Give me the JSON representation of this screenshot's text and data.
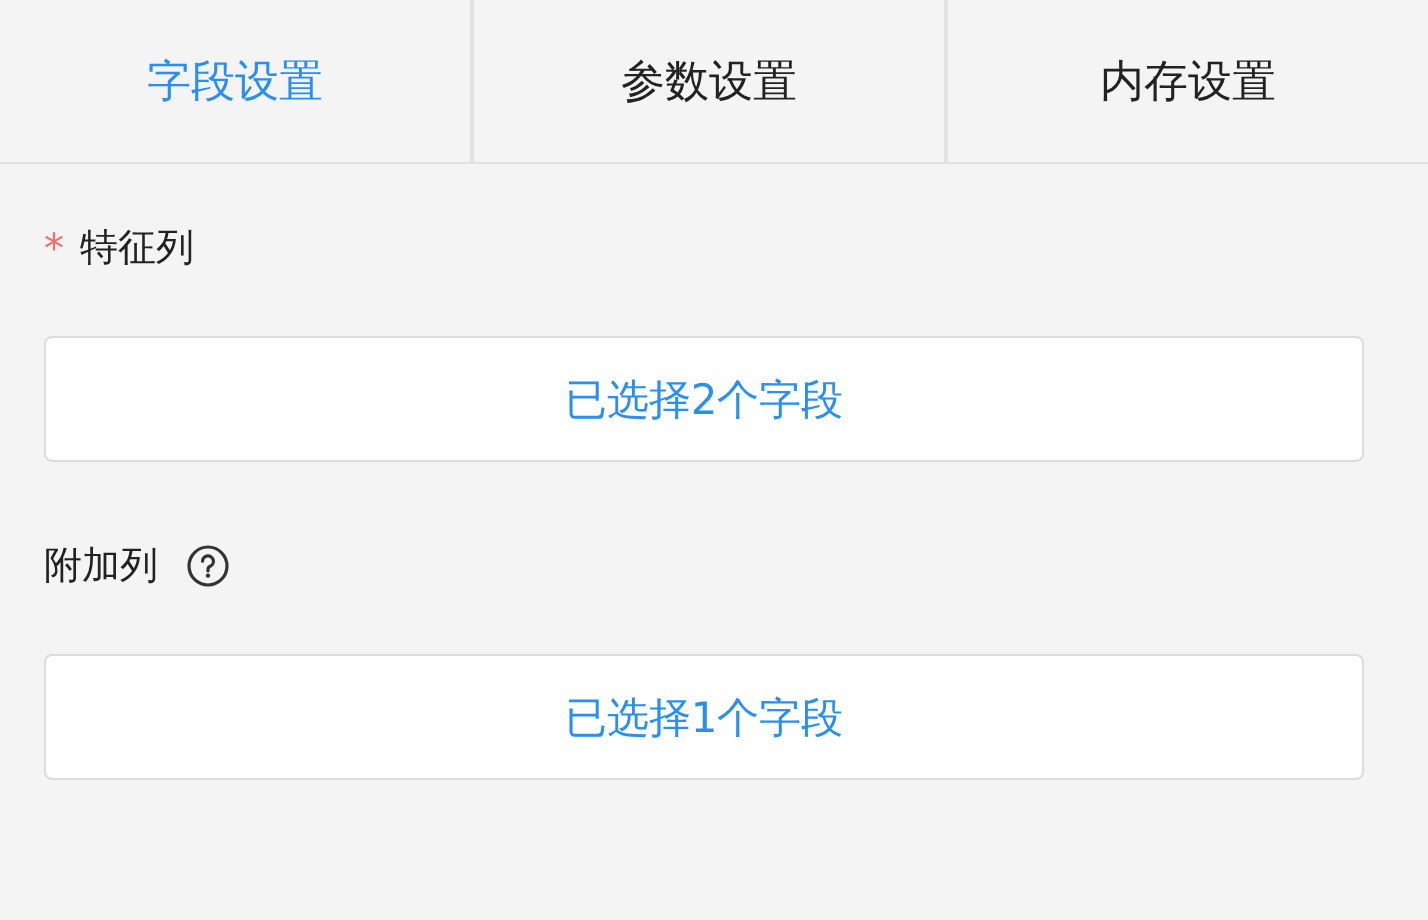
{
  "tabs": [
    {
      "label": "字段设置",
      "selected": true
    },
    {
      "label": "参数设置",
      "selected": false
    },
    {
      "label": "内存设置",
      "selected": false
    }
  ],
  "fields": [
    {
      "required_mark": "*",
      "label": "特征列",
      "help": false,
      "button": "已选择2个字段"
    },
    {
      "label": "附加列",
      "help": true,
      "button": "已选择1个字段"
    }
  ]
}
